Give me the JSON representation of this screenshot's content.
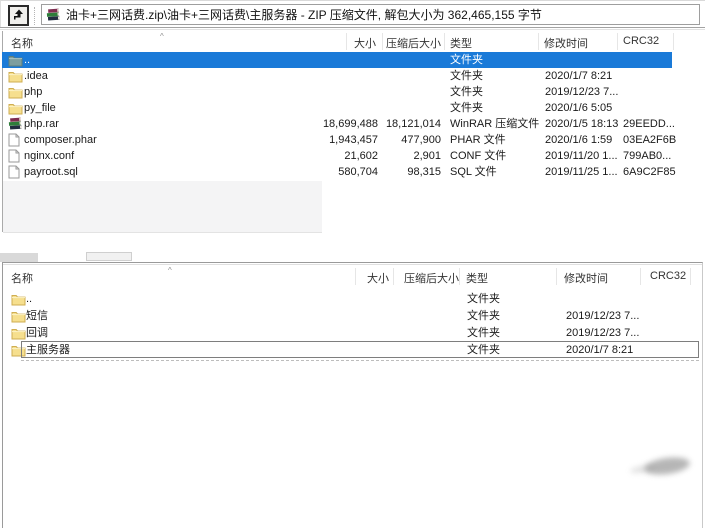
{
  "colors": {
    "selection_blue": "#1a7ad8",
    "folder_yellow": "#f6df8e",
    "folder_border": "#cfae52",
    "up_folder_teal": "#7d9e9e",
    "window_border": "#9a9a9a",
    "gray_patch": "#f4f4f5"
  },
  "top_window": {
    "toolbar": {
      "up_button_icon": "up-arrow-icon",
      "archive_icon": "winrar-books-icon",
      "address_text": "油卡+三网话费.zip\\油卡+三网话费\\主服务器 - ZIP 压缩文件, 解包大小为 362,465,155 字节"
    },
    "sort_indicator": "^",
    "columns": [
      "名称",
      "大小",
      "压缩后大小",
      "类型",
      "修改时间",
      "CRC32"
    ],
    "rows": [
      {
        "name": "..",
        "icon": "folder-up",
        "size": "",
        "packed": "",
        "type": "文件夹",
        "modified": "",
        "crc": "",
        "selected": true
      },
      {
        "name": ".idea",
        "icon": "folder",
        "size": "",
        "packed": "",
        "type": "文件夹",
        "modified": "2020/1/7 8:21",
        "crc": ""
      },
      {
        "name": "php",
        "icon": "folder",
        "size": "",
        "packed": "",
        "type": "文件夹",
        "modified": "2019/12/23 7...",
        "crc": ""
      },
      {
        "name": "py_file",
        "icon": "folder",
        "size": "",
        "packed": "",
        "type": "文件夹",
        "modified": "2020/1/6 5:05",
        "crc": ""
      },
      {
        "name": "php.rar",
        "icon": "rar",
        "size": "18,699,488",
        "packed": "18,121,014",
        "type": "WinRAR 压缩文件",
        "modified": "2020/1/5 18:13",
        "crc": "29EEDD..."
      },
      {
        "name": "composer.phar",
        "icon": "file",
        "size": "1,943,457",
        "packed": "477,900",
        "type": "PHAR 文件",
        "modified": "2020/1/6 1:59",
        "crc": "03EA2F6B"
      },
      {
        "name": "nginx.conf",
        "icon": "file",
        "size": "21,602",
        "packed": "2,901",
        "type": "CONF 文件",
        "modified": "2019/11/20 1...",
        "crc": "799AB0..."
      },
      {
        "name": "payroot.sql",
        "icon": "file",
        "size": "580,704",
        "packed": "98,315",
        "type": "SQL 文件",
        "modified": "2019/11/25 1...",
        "crc": "6A9C2F85"
      }
    ]
  },
  "bottom_window": {
    "sort_indicator": "^",
    "columns": [
      "名称",
      "大小",
      "压缩后大小",
      "类型",
      "修改时间",
      "CRC32"
    ],
    "rows": [
      {
        "name": "..",
        "icon": "folder",
        "size": "",
        "packed": "",
        "type": "文件夹",
        "modified": "",
        "crc": ""
      },
      {
        "name": "短信",
        "icon": "folder",
        "size": "",
        "packed": "",
        "type": "文件夹",
        "modified": "2019/12/23 7...",
        "crc": ""
      },
      {
        "name": "回调",
        "icon": "folder",
        "size": "",
        "packed": "",
        "type": "文件夹",
        "modified": "2019/12/23 7...",
        "crc": ""
      },
      {
        "name": "主服务器",
        "icon": "folder",
        "size": "",
        "packed": "",
        "type": "文件夹",
        "modified": "2020/1/7 8:21",
        "crc": "",
        "focused": true
      }
    ]
  }
}
